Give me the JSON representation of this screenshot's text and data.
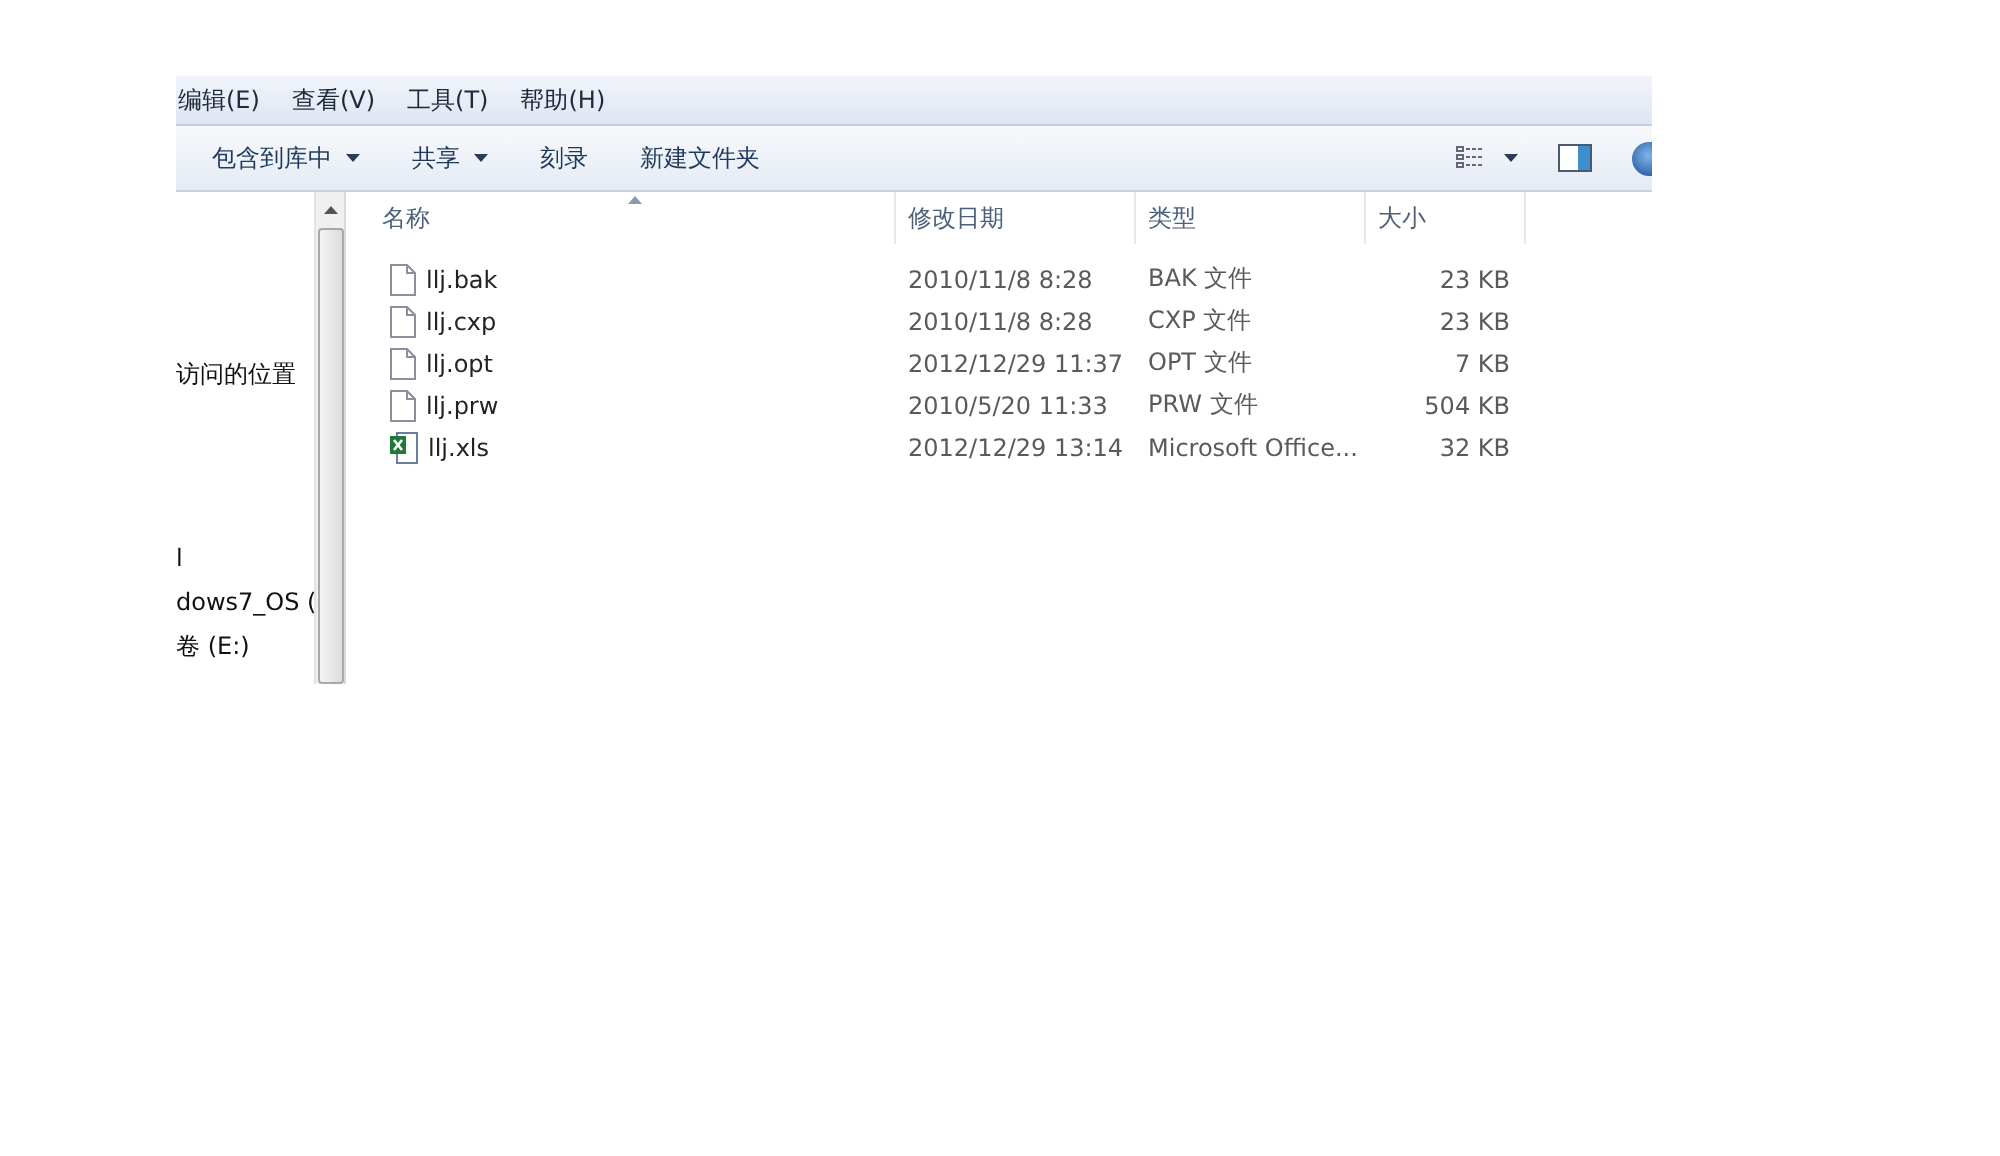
{
  "menu_bar": {
    "items": [
      "编辑(E)",
      "查看(V)",
      "工具(T)",
      "帮助(H)"
    ]
  },
  "toolbar": {
    "buttons": [
      {
        "label": "包含到库中",
        "dropdown": true
      },
      {
        "label": "共享",
        "dropdown": true
      },
      {
        "label": "刻录",
        "dropdown": false
      },
      {
        "label": "新建文件夹",
        "dropdown": false
      }
    ]
  },
  "sidebar": {
    "items": [
      "访问的位置",
      "l",
      "dows7_OS (",
      "卷 (E:)"
    ]
  },
  "table": {
    "columns": [
      "名称",
      "修改日期",
      "类型",
      "大小"
    ],
    "rows": [
      {
        "kind": "file",
        "name": "llj.bak",
        "modified": "2010/11/8 8:28",
        "type": "BAK 文件",
        "size": "23 KB"
      },
      {
        "kind": "file",
        "name": "llj.cxp",
        "modified": "2010/11/8 8:28",
        "type": "CXP 文件",
        "size": "23 KB"
      },
      {
        "kind": "file",
        "name": "llj.opt",
        "modified": "2012/12/29 11:37",
        "type": "OPT 文件",
        "size": "7 KB"
      },
      {
        "kind": "file",
        "name": "llj.prw",
        "modified": "2010/5/20 11:33",
        "type": "PRW 文件",
        "size": "504 KB"
      },
      {
        "kind": "excel",
        "name": "llj.xls",
        "modified": "2012/12/29 13:14",
        "type": "Microsoft Office...",
        "size": "32 KB"
      }
    ]
  }
}
